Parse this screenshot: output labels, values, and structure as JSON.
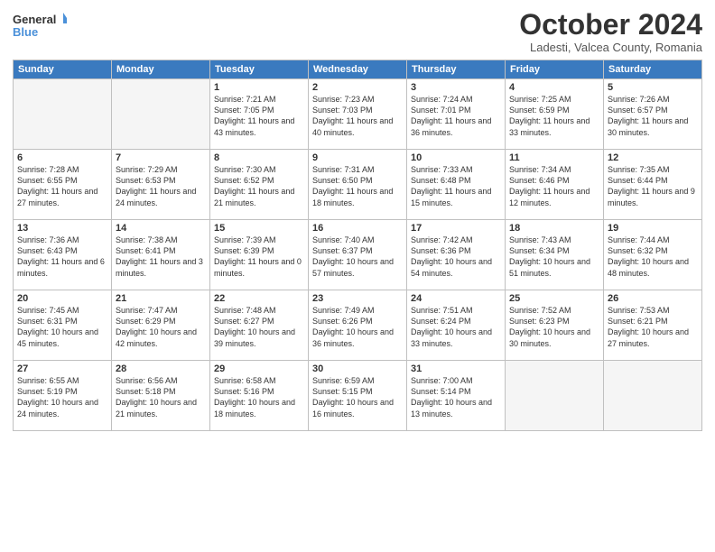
{
  "header": {
    "logo_general": "General",
    "logo_blue": "Blue",
    "month": "October 2024",
    "location": "Ladesti, Valcea County, Romania"
  },
  "weekdays": [
    "Sunday",
    "Monday",
    "Tuesday",
    "Wednesday",
    "Thursday",
    "Friday",
    "Saturday"
  ],
  "weeks": [
    [
      {
        "day": "",
        "info": ""
      },
      {
        "day": "",
        "info": ""
      },
      {
        "day": "1",
        "info": "Sunrise: 7:21 AM\nSunset: 7:05 PM\nDaylight: 11 hours and 43 minutes."
      },
      {
        "day": "2",
        "info": "Sunrise: 7:23 AM\nSunset: 7:03 PM\nDaylight: 11 hours and 40 minutes."
      },
      {
        "day": "3",
        "info": "Sunrise: 7:24 AM\nSunset: 7:01 PM\nDaylight: 11 hours and 36 minutes."
      },
      {
        "day": "4",
        "info": "Sunrise: 7:25 AM\nSunset: 6:59 PM\nDaylight: 11 hours and 33 minutes."
      },
      {
        "day": "5",
        "info": "Sunrise: 7:26 AM\nSunset: 6:57 PM\nDaylight: 11 hours and 30 minutes."
      }
    ],
    [
      {
        "day": "6",
        "info": "Sunrise: 7:28 AM\nSunset: 6:55 PM\nDaylight: 11 hours and 27 minutes."
      },
      {
        "day": "7",
        "info": "Sunrise: 7:29 AM\nSunset: 6:53 PM\nDaylight: 11 hours and 24 minutes."
      },
      {
        "day": "8",
        "info": "Sunrise: 7:30 AM\nSunset: 6:52 PM\nDaylight: 11 hours and 21 minutes."
      },
      {
        "day": "9",
        "info": "Sunrise: 7:31 AM\nSunset: 6:50 PM\nDaylight: 11 hours and 18 minutes."
      },
      {
        "day": "10",
        "info": "Sunrise: 7:33 AM\nSunset: 6:48 PM\nDaylight: 11 hours and 15 minutes."
      },
      {
        "day": "11",
        "info": "Sunrise: 7:34 AM\nSunset: 6:46 PM\nDaylight: 11 hours and 12 minutes."
      },
      {
        "day": "12",
        "info": "Sunrise: 7:35 AM\nSunset: 6:44 PM\nDaylight: 11 hours and 9 minutes."
      }
    ],
    [
      {
        "day": "13",
        "info": "Sunrise: 7:36 AM\nSunset: 6:43 PM\nDaylight: 11 hours and 6 minutes."
      },
      {
        "day": "14",
        "info": "Sunrise: 7:38 AM\nSunset: 6:41 PM\nDaylight: 11 hours and 3 minutes."
      },
      {
        "day": "15",
        "info": "Sunrise: 7:39 AM\nSunset: 6:39 PM\nDaylight: 11 hours and 0 minutes."
      },
      {
        "day": "16",
        "info": "Sunrise: 7:40 AM\nSunset: 6:37 PM\nDaylight: 10 hours and 57 minutes."
      },
      {
        "day": "17",
        "info": "Sunrise: 7:42 AM\nSunset: 6:36 PM\nDaylight: 10 hours and 54 minutes."
      },
      {
        "day": "18",
        "info": "Sunrise: 7:43 AM\nSunset: 6:34 PM\nDaylight: 10 hours and 51 minutes."
      },
      {
        "day": "19",
        "info": "Sunrise: 7:44 AM\nSunset: 6:32 PM\nDaylight: 10 hours and 48 minutes."
      }
    ],
    [
      {
        "day": "20",
        "info": "Sunrise: 7:45 AM\nSunset: 6:31 PM\nDaylight: 10 hours and 45 minutes."
      },
      {
        "day": "21",
        "info": "Sunrise: 7:47 AM\nSunset: 6:29 PM\nDaylight: 10 hours and 42 minutes."
      },
      {
        "day": "22",
        "info": "Sunrise: 7:48 AM\nSunset: 6:27 PM\nDaylight: 10 hours and 39 minutes."
      },
      {
        "day": "23",
        "info": "Sunrise: 7:49 AM\nSunset: 6:26 PM\nDaylight: 10 hours and 36 minutes."
      },
      {
        "day": "24",
        "info": "Sunrise: 7:51 AM\nSunset: 6:24 PM\nDaylight: 10 hours and 33 minutes."
      },
      {
        "day": "25",
        "info": "Sunrise: 7:52 AM\nSunset: 6:23 PM\nDaylight: 10 hours and 30 minutes."
      },
      {
        "day": "26",
        "info": "Sunrise: 7:53 AM\nSunset: 6:21 PM\nDaylight: 10 hours and 27 minutes."
      }
    ],
    [
      {
        "day": "27",
        "info": "Sunrise: 6:55 AM\nSunset: 5:19 PM\nDaylight: 10 hours and 24 minutes."
      },
      {
        "day": "28",
        "info": "Sunrise: 6:56 AM\nSunset: 5:18 PM\nDaylight: 10 hours and 21 minutes."
      },
      {
        "day": "29",
        "info": "Sunrise: 6:58 AM\nSunset: 5:16 PM\nDaylight: 10 hours and 18 minutes."
      },
      {
        "day": "30",
        "info": "Sunrise: 6:59 AM\nSunset: 5:15 PM\nDaylight: 10 hours and 16 minutes."
      },
      {
        "day": "31",
        "info": "Sunrise: 7:00 AM\nSunset: 5:14 PM\nDaylight: 10 hours and 13 minutes."
      },
      {
        "day": "",
        "info": ""
      },
      {
        "day": "",
        "info": ""
      }
    ]
  ]
}
